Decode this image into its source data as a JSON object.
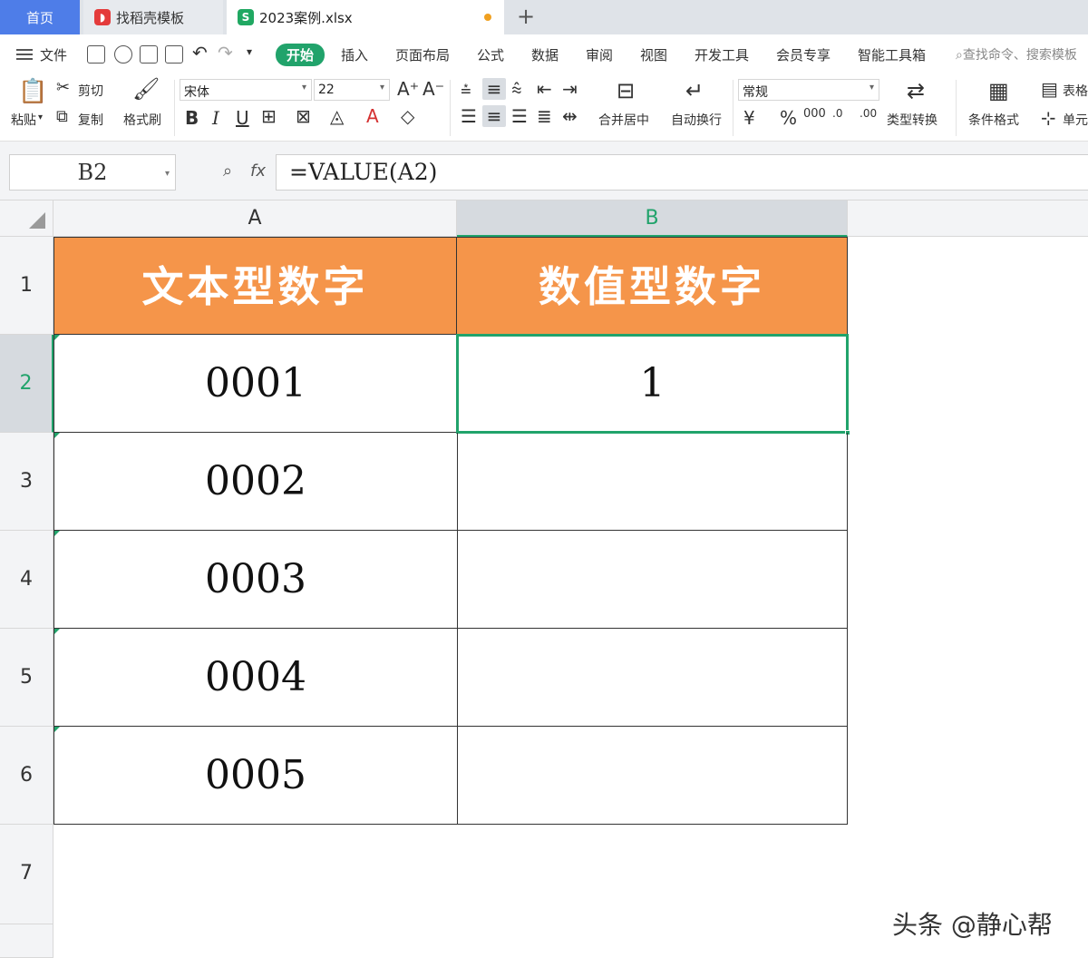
{
  "tabs": {
    "home": "首页",
    "daoke": "找稻壳模板",
    "file": "2023案例.xlsx",
    "file_icon": "S",
    "plus": "+"
  },
  "menu": {
    "file": "文件",
    "items": [
      "开始",
      "插入",
      "页面布局",
      "公式",
      "数据",
      "审阅",
      "视图",
      "开发工具",
      "会员专享",
      "智能工具箱"
    ],
    "search": "查找命令、搜索模板"
  },
  "ribbon": {
    "paste": "粘贴",
    "cut": "剪切",
    "copy": "复制",
    "format_painter": "格式刷",
    "font_name": "宋体",
    "font_size": "22",
    "merge": "合并居中",
    "wrap": "自动换行",
    "number_format": "常规",
    "type_convert": "类型转换",
    "cond_format": "条件格式",
    "table_style": "表格",
    "cell": "单元"
  },
  "formula_bar": {
    "name_box": "B2",
    "fx": "fx",
    "formula": "=VALUE(A2)"
  },
  "sheet": {
    "columns": [
      "A",
      "B"
    ],
    "rows": [
      "1",
      "2",
      "3",
      "4",
      "5",
      "6",
      "7"
    ],
    "header_a": "文本型数字",
    "header_b": "数值型数字",
    "col_a_values": [
      "0001",
      "0002",
      "0003",
      "0004",
      "0005"
    ],
    "col_b_values": [
      "1",
      "",
      "",
      "",
      ""
    ],
    "selected_cell": "B2",
    "header_fill": "#f5954a",
    "accent": "#21a36b"
  },
  "watermark": "头条 @静心帮"
}
